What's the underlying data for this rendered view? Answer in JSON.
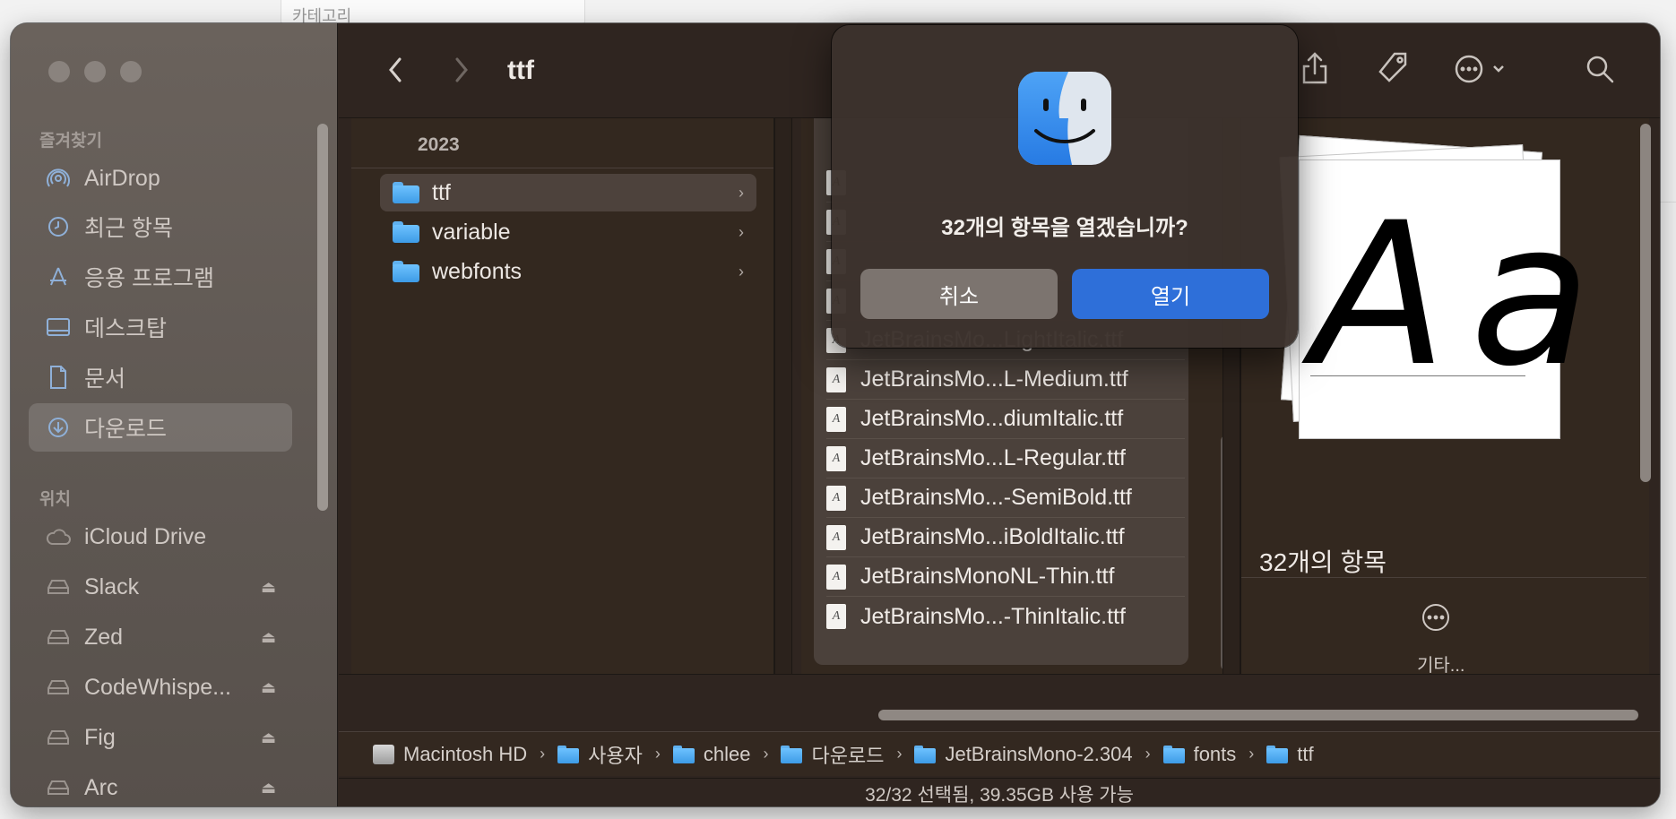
{
  "background": {
    "hint_text": "카테고리"
  },
  "window": {
    "title": "ttf",
    "sidebar": {
      "favorites_header": "즐겨찾기",
      "favorites": [
        {
          "label": "AirDrop",
          "icon": "airdrop-icon"
        },
        {
          "label": "최근 항목",
          "icon": "clock-icon"
        },
        {
          "label": "응용 프로그램",
          "icon": "applications-icon"
        },
        {
          "label": "데스크탑",
          "icon": "desktop-icon"
        },
        {
          "label": "문서",
          "icon": "document-icon"
        },
        {
          "label": "다운로드",
          "icon": "download-icon"
        }
      ],
      "locations_header": "위치",
      "locations": [
        {
          "label": "iCloud Drive",
          "icon": "cloud-icon"
        },
        {
          "label": "Slack",
          "icon": "drive-icon"
        },
        {
          "label": "Zed",
          "icon": "drive-icon"
        },
        {
          "label": "CodeWhispe...",
          "icon": "drive-icon"
        },
        {
          "label": "Fig",
          "icon": "drive-icon"
        },
        {
          "label": "Arc",
          "icon": "drive-icon"
        }
      ]
    },
    "column1": {
      "header": "2023",
      "items": [
        {
          "label": "ttf",
          "selected": true
        },
        {
          "label": "variable",
          "selected": false
        },
        {
          "label": "webfonts",
          "selected": false
        }
      ]
    },
    "column2": {
      "files": [
        "JetBrainsMo...LightItalic.ttf",
        "JetBrainsMo...L-Medium.ttf",
        "JetBrainsMo...diumItalic.ttf",
        "JetBrainsMo...L-Regular.ttf",
        "JetBrainsMo...-SemiBold.ttf",
        "JetBrainsMo...iBoldItalic.ttf",
        "JetBrainsMonoNL-Thin.ttf",
        "JetBrainsMo...-ThinItalic.ttf"
      ]
    },
    "preview": {
      "glyph": "Aa",
      "count": "32개의 항목",
      "more_label": "기타..."
    },
    "pathbar": [
      {
        "label": "Macintosh HD",
        "icon": "hard-drive-icon"
      },
      {
        "label": "사용자",
        "icon": "folder-icon"
      },
      {
        "label": "chlee",
        "icon": "folder-icon"
      },
      {
        "label": "다운로드",
        "icon": "folder-icon"
      },
      {
        "label": "JetBrainsMono-2.304",
        "icon": "folder-icon"
      },
      {
        "label": "fonts",
        "icon": "folder-icon"
      },
      {
        "label": "ttf",
        "icon": "folder-icon"
      }
    ],
    "status": "32/32 선택됨, 39.35GB 사용 가능"
  },
  "dialog": {
    "message": "32개의 항목을 열겠습니까?",
    "cancel_label": "취소",
    "open_label": "열기"
  },
  "colors": {
    "accent": "#2e6fd9",
    "folder": "#4aa8f0",
    "window_bg": "#2f2520",
    "sidebar_bg": "#625a55"
  }
}
